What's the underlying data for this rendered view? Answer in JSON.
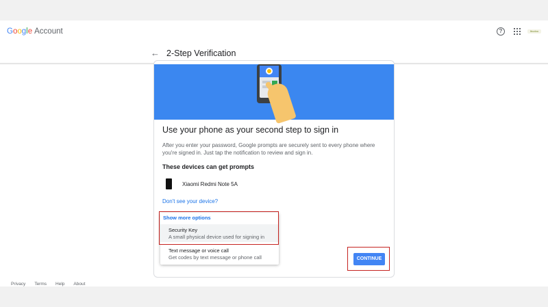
{
  "header": {
    "logo": {
      "g": "G",
      "o1": "o",
      "o2": "o",
      "g2": "g",
      "l": "l",
      "e": "e",
      "account": "Account"
    },
    "help_icon": "?",
    "avatar_text": "Ibudou"
  },
  "title_bar": {
    "back_arrow": "←",
    "title": "2-Step Verification"
  },
  "card": {
    "headline": "Use your phone as your second step to sign in",
    "body": "After you enter your password, Google prompts are securely sent to every phone where you're signed in. Just tap the notification to review and sign in.",
    "devices_heading": "These devices can get prompts",
    "device_name": "Xiaomi Redmi Note 5A",
    "dont_see_link": "Don't see your device?"
  },
  "more_options": {
    "title": "Show more options",
    "options": [
      {
        "name": "Security Key",
        "desc": "A small physical device used for signing in"
      },
      {
        "name": "Text message or voice call",
        "desc": "Get codes by text message or phone call"
      }
    ]
  },
  "continue_label": "CONTINUE",
  "footer": {
    "links": [
      "Privacy",
      "Terms",
      "Help",
      "About"
    ]
  },
  "colors": {
    "hero_blue": "#3b87f0",
    "button_blue": "#4285f4",
    "link_blue": "#1a73e8",
    "highlight_red": "#c5221f"
  }
}
